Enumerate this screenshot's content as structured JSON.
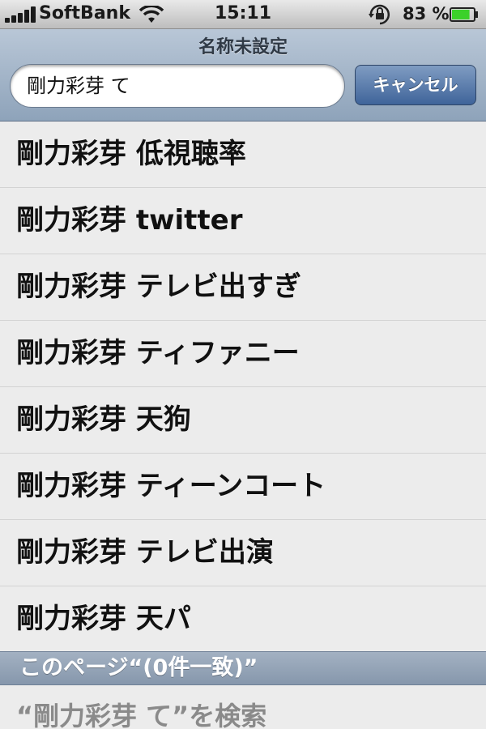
{
  "status_bar": {
    "carrier": "SoftBank",
    "time": "15:11",
    "battery_percent": "83 %",
    "signal_icon": "signal-bars-icon",
    "wifi_icon": "wifi-icon",
    "rotation_lock_icon": "rotation-lock-icon",
    "battery_icon": "battery-icon",
    "battery_level": 0.83,
    "battery_color": "#3bd12a"
  },
  "header": {
    "title": "名称未設定"
  },
  "search": {
    "value": "剛力彩芽 て",
    "cancel_label": "キャンセル"
  },
  "suggestions": [
    "剛力彩芽 低視聴率",
    "剛力彩芽 twitter",
    "剛力彩芽 テレビ出すぎ",
    "剛力彩芽 ティファニー",
    "剛力彩芽 天狗",
    "剛力彩芽 ティーンコート",
    "剛力彩芽 テレビ出演",
    "剛力彩芽 天パ"
  ],
  "find_on_page": {
    "header": "このページ“(0件一致)”",
    "search_row": "“剛力彩芽 て”を検索"
  }
}
